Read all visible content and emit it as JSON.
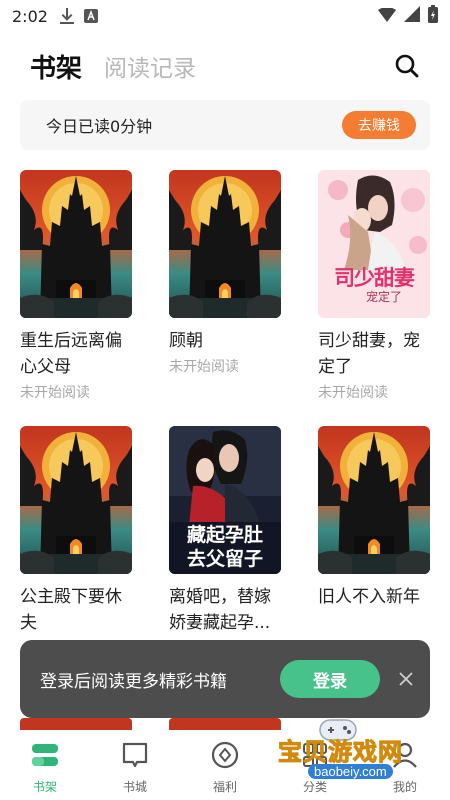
{
  "status_bar": {
    "time": "2:02"
  },
  "header": {
    "tabs": [
      {
        "label": "书架",
        "active": true
      },
      {
        "label": "阅读记录",
        "active": false
      }
    ]
  },
  "banner": {
    "text": "今日已读0分钟",
    "button_label": "去赚钱"
  },
  "books": [
    {
      "title": "重生后远离偏心父母",
      "status": "未开始阅读",
      "cover": "castle"
    },
    {
      "title": "顾朝",
      "status": "未开始阅读",
      "cover": "castle"
    },
    {
      "title": "司少甜妻，宠定了",
      "status": "未开始阅读",
      "cover": "pink-romance"
    },
    {
      "title": "公主殿下要休夫",
      "status": "",
      "cover": "castle"
    },
    {
      "title": "离婚吧，替嫁娇妻藏起孕...",
      "status": "",
      "cover": "dark-romance"
    },
    {
      "title": "旧人不入新年",
      "status": "",
      "cover": "castle"
    }
  ],
  "covers": {
    "pink_romance": {
      "line1": "司少甜妻",
      "line2": "宠定了"
    },
    "dark_romance": {
      "line1": "藏起孕肚",
      "line2": "去父留子"
    }
  },
  "toast": {
    "text": "登录后阅读更多精彩书籍",
    "button_label": "登录"
  },
  "bottom_nav": {
    "items": [
      {
        "label": "书架",
        "icon": "bookshelf-icon",
        "active": true
      },
      {
        "label": "书城",
        "icon": "book-city-icon",
        "active": false
      },
      {
        "label": "福利",
        "icon": "welfare-icon",
        "active": false
      },
      {
        "label": "分类",
        "icon": "category-icon",
        "active": false
      },
      {
        "label": "我的",
        "icon": "profile-icon",
        "active": false
      }
    ]
  },
  "watermark": {
    "text": "宝贝游戏网",
    "url": "baobeiy.com"
  },
  "colors": {
    "accent_green": "#46c28a",
    "earn_orange": "#f57d32",
    "toast_bg": "#4d4d4d"
  }
}
